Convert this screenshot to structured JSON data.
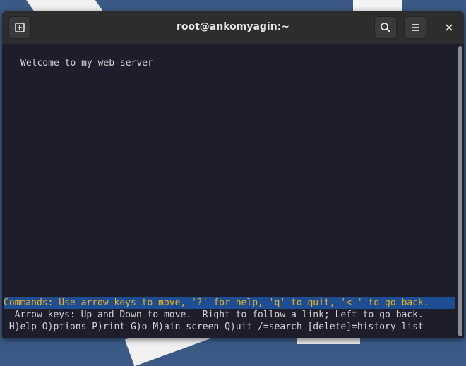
{
  "window": {
    "title": "root@ankomyagin:~"
  },
  "headerbar": {
    "new_tab_icon": "new-tab-icon",
    "search_icon": "search-icon",
    "menu_icon": "hamburger-menu-icon",
    "close_icon": "close-icon"
  },
  "terminal": {
    "page_text": "Welcome to my web-server",
    "commands_line": "Commands: Use arrow keys to move, '?' for help, 'q' to quit, '<-' to go back.",
    "arrow_keys_line": "  Arrow keys: Up and Down to move.  Right to follow a link; Left to go back.",
    "help_line": " H)elp O)ptions P)rint G)o M)ain screen Q)uit /=search [delete]=history list"
  },
  "colors": {
    "terminal_bg": "#1e1d2b",
    "headerbar_bg": "#2d2d2d",
    "status_bar_bg": "#1d4d93",
    "status_text": "#f0b21c"
  }
}
